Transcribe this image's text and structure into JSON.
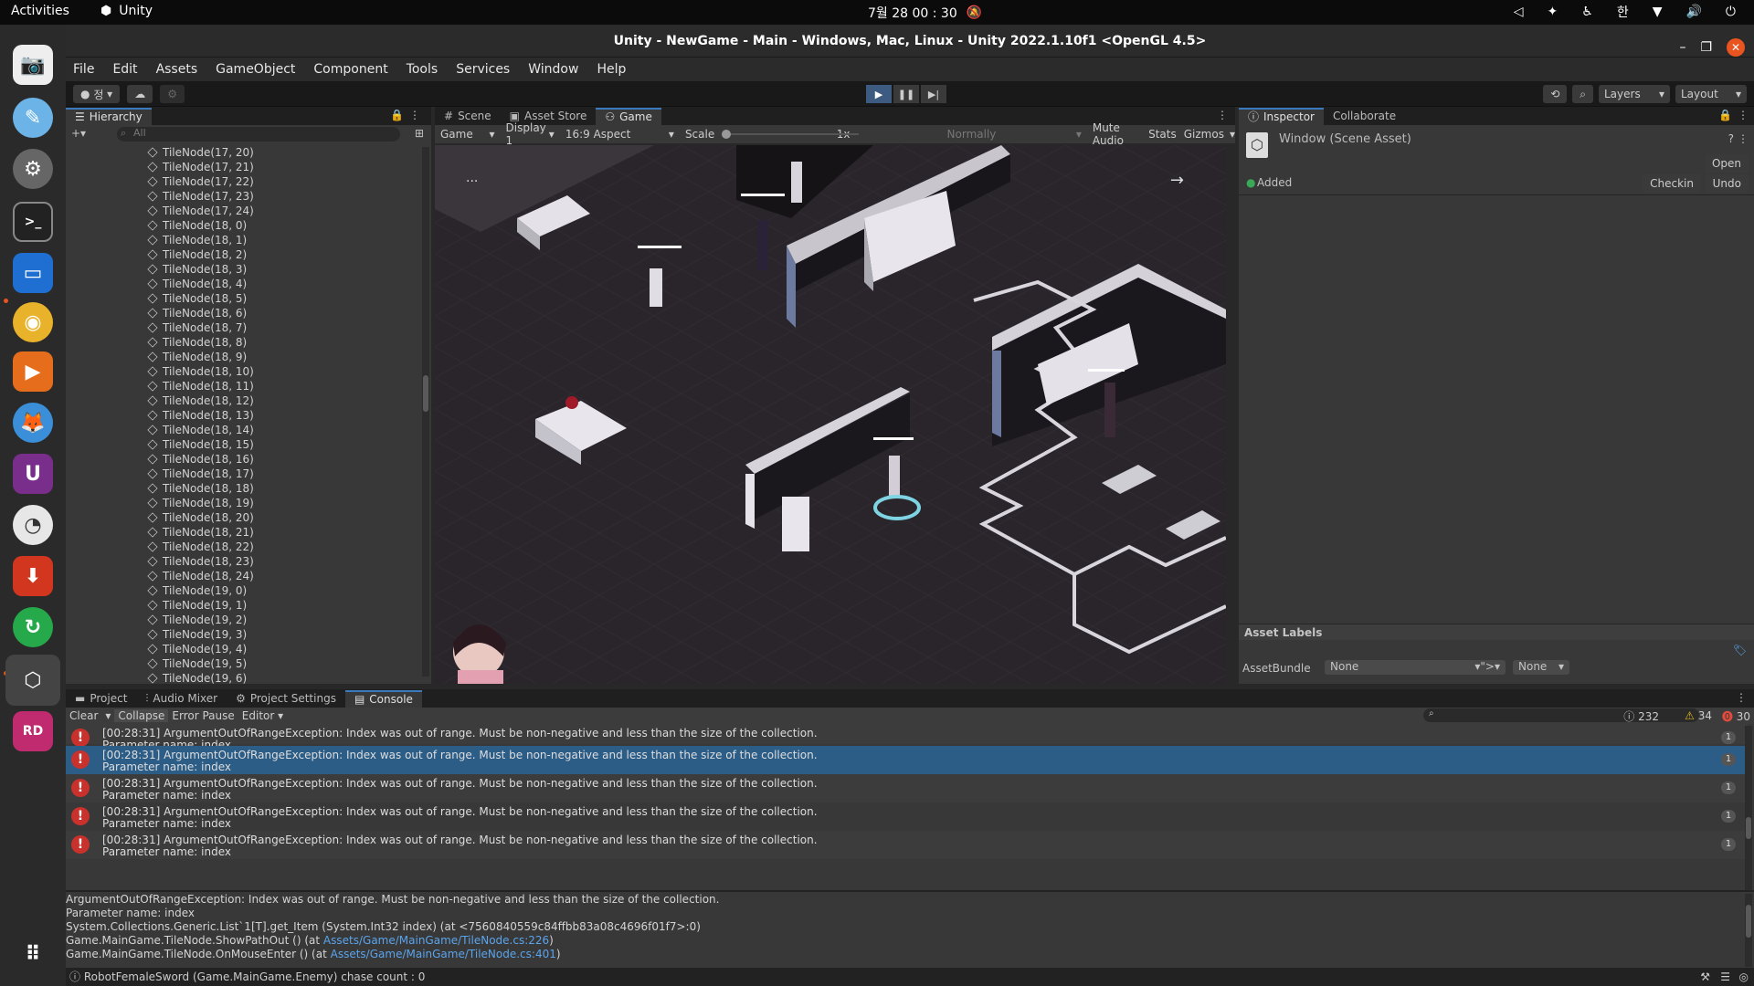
{
  "os": {
    "activities": "Activities",
    "app_name": "Unity",
    "clock": "7월 28 00 : 30",
    "ime": "한"
  },
  "window": {
    "title": "Unity - NewGame - Main - Windows, Mac, Linux - Unity 2022.1.10f1 <OpenGL 4.5>"
  },
  "menu": [
    "File",
    "Edit",
    "Assets",
    "GameObject",
    "Component",
    "Tools",
    "Services",
    "Window",
    "Help"
  ],
  "toolbar": {
    "account": "정",
    "layers": "Layers",
    "layout": "Layout"
  },
  "hierarchy": {
    "tab": "Hierarchy",
    "search_placeholder": "All",
    "items": [
      "TileNode(17, 20)",
      "TileNode(17, 21)",
      "TileNode(17, 22)",
      "TileNode(17, 23)",
      "TileNode(17, 24)",
      "TileNode(18, 0)",
      "TileNode(18, 1)",
      "TileNode(18, 2)",
      "TileNode(18, 3)",
      "TileNode(18, 4)",
      "TileNode(18, 5)",
      "TileNode(18, 6)",
      "TileNode(18, 7)",
      "TileNode(18, 8)",
      "TileNode(18, 9)",
      "TileNode(18, 10)",
      "TileNode(18, 11)",
      "TileNode(18, 12)",
      "TileNode(18, 13)",
      "TileNode(18, 14)",
      "TileNode(18, 15)",
      "TileNode(18, 16)",
      "TileNode(18, 17)",
      "TileNode(18, 18)",
      "TileNode(18, 19)",
      "TileNode(18, 20)",
      "TileNode(18, 21)",
      "TileNode(18, 22)",
      "TileNode(18, 23)",
      "TileNode(18, 24)",
      "TileNode(19, 0)",
      "TileNode(19, 1)",
      "TileNode(19, 2)",
      "TileNode(19, 3)",
      "TileNode(19, 4)",
      "TileNode(19, 5)",
      "TileNode(19, 6)"
    ]
  },
  "game": {
    "tabs": [
      "Scene",
      "Asset Store",
      "Game"
    ],
    "mode": "Game",
    "display": "Display 1",
    "aspect": "16:9 Aspect",
    "scale_label": "Scale",
    "scale_value": "1x",
    "play_focus": "Normally",
    "mute": "Mute Audio",
    "stats": "Stats",
    "gizmos": "Gizmos",
    "more": "...",
    "next": "→"
  },
  "inspector": {
    "tabs": [
      "Inspector",
      "Collaborate"
    ],
    "asset_title": "Window (Scene Asset)",
    "open": "Open",
    "status": "Added",
    "checkin": "Checkin",
    "undo": "Undo",
    "asset_labels": "Asset Labels",
    "assetbundle_label": "AssetBundle",
    "assetbundle_value": "None",
    "variant_value": "None"
  },
  "console": {
    "tabs": [
      "Project",
      "Audio Mixer",
      "Project Settings",
      "Console"
    ],
    "clear": "Clear",
    "collapse": "Collapse",
    "error_pause": "Error Pause",
    "editor": "Editor",
    "counts": {
      "info": "232",
      "warn": "34",
      "error": "30"
    },
    "entries": [
      {
        "line1": "[00:28:31] ArgumentOutOfRangeException: Index was out of range. Must be non-negative and less than the size of the collection.",
        "line2": "Parameter name: index",
        "count": "1"
      },
      {
        "line1": "[00:28:31] ArgumentOutOfRangeException: Index was out of range. Must be non-negative and less than the size of the collection.",
        "line2": "Parameter name: index",
        "count": "1"
      },
      {
        "line1": "[00:28:31] ArgumentOutOfRangeException: Index was out of range. Must be non-negative and less than the size of the collection.",
        "line2": "Parameter name: index",
        "count": "1"
      },
      {
        "line1": "[00:28:31] ArgumentOutOfRangeException: Index was out of range. Must be non-negative and less than the size of the collection.",
        "line2": "Parameter name: index",
        "count": "1"
      },
      {
        "line1": "[00:28:31] ArgumentOutOfRangeException: Index was out of range. Must be non-negative and less than the size of the collection.",
        "line2": "Parameter name: index",
        "count": "1"
      }
    ],
    "detail": {
      "l1": "ArgumentOutOfRangeException: Index was out of range. Must be non-negative and less than the size of the collection.",
      "l2": "Parameter name: index",
      "l3": "System.Collections.Generic.List`1[T].get_Item (System.Int32 index) (at <7560840559c84ffbb83a08c4696f01f7>:0)",
      "l4_pre": "Game.MainGame.TileNode.ShowPathOut () (at ",
      "l4_link": "Assets/Game/MainGame/TileNode.cs:226",
      "l4_post": ")",
      "l5_pre": "Game.MainGame.TileNode.OnMouseEnter () (at ",
      "l5_link": "Assets/Game/MainGame/TileNode.cs:401",
      "l5_post": ")"
    }
  },
  "status": {
    "message": "RobotFemaleSword (Game.MainGame.Enemy) chase count : 0"
  }
}
